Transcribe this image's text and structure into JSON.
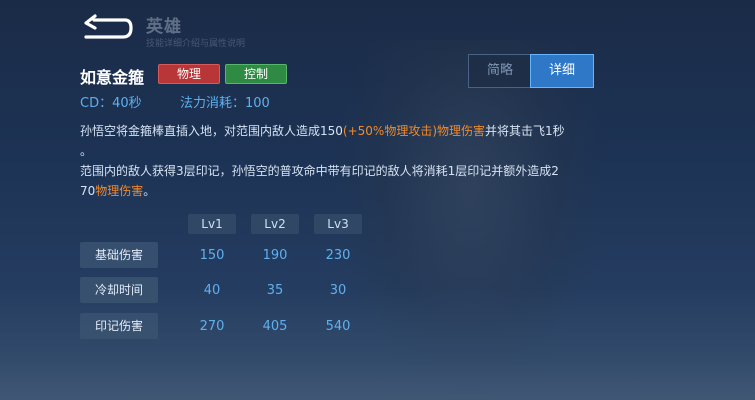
{
  "header": {
    "title": "英雄",
    "subtitle": "技能详细介绍与属性说明"
  },
  "skill": {
    "name": "如意金箍",
    "tags": [
      "物理",
      "控制"
    ],
    "cd": "CD：40秒",
    "mana": "法力消耗：100"
  },
  "view_toggle": {
    "brief": "简略",
    "detail": "详细",
    "selected": "详细"
  },
  "description": {
    "line1_a": "孙悟空将金箍棒直插入地，对范围内敌人造成150",
    "line1_highlight": "(+50%物理攻击)物理伤害",
    "line1_b": "并将其击飞1秒",
    "line1_c": "。",
    "line2_a": "范围内的敌人获得3层印记，孙悟空的普攻命中带有印记的敌人将消耗1层印记并额外造成2",
    "line2_b": "70",
    "line2_highlight": "物理伤害",
    "line2_c": "。"
  },
  "level_table": {
    "levels": [
      "Lv1",
      "Lv2",
      "Lv3"
    ],
    "rows": [
      {
        "label": "基础伤害",
        "values": [
          "150",
          "190",
          "230"
        ]
      },
      {
        "label": "冷却时间",
        "values": [
          "40",
          "35",
          "30"
        ]
      },
      {
        "label": "印记伤害",
        "values": [
          "270",
          "405",
          "540"
        ]
      }
    ]
  },
  "colors": {
    "accent_blue": "#5fb0ee",
    "highlight_orange": "#f08a2c",
    "tag_physical": "#b83638",
    "tag_control": "#2f8a43"
  },
  "icons": {
    "back": "back-arrow-icon"
  }
}
